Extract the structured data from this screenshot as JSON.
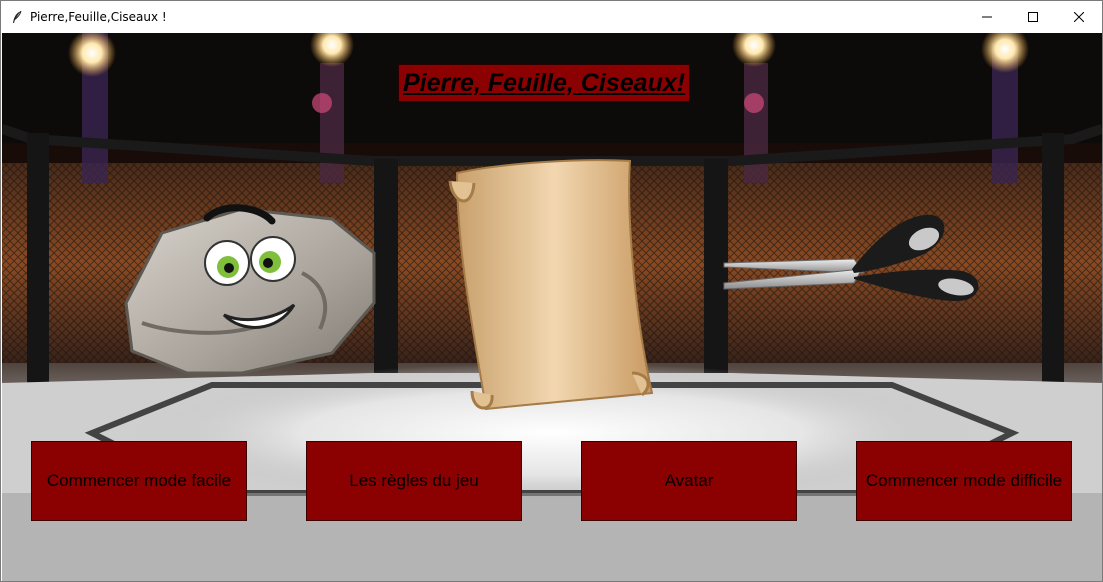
{
  "window": {
    "title": "Pierre,Feuille,Ciseaux !",
    "icon": "feather-icon",
    "controls": [
      "minimize-icon",
      "maximize-icon",
      "close-icon"
    ]
  },
  "game": {
    "title": "Pierre, Feuille, Ciseaux!"
  },
  "sprites": {
    "rock": "rock-icon",
    "paper": "paper-scroll-icon",
    "scissors": "scissors-icon"
  },
  "buttons": {
    "easy_label": "Commencer mode facile",
    "rules_label": "Les règles du jeu",
    "avatar_label": "Avatar",
    "hard_label": "Commencer mode difficile"
  },
  "colors": {
    "button_bg": "#8b0000",
    "title_bg": "#8b0000"
  }
}
